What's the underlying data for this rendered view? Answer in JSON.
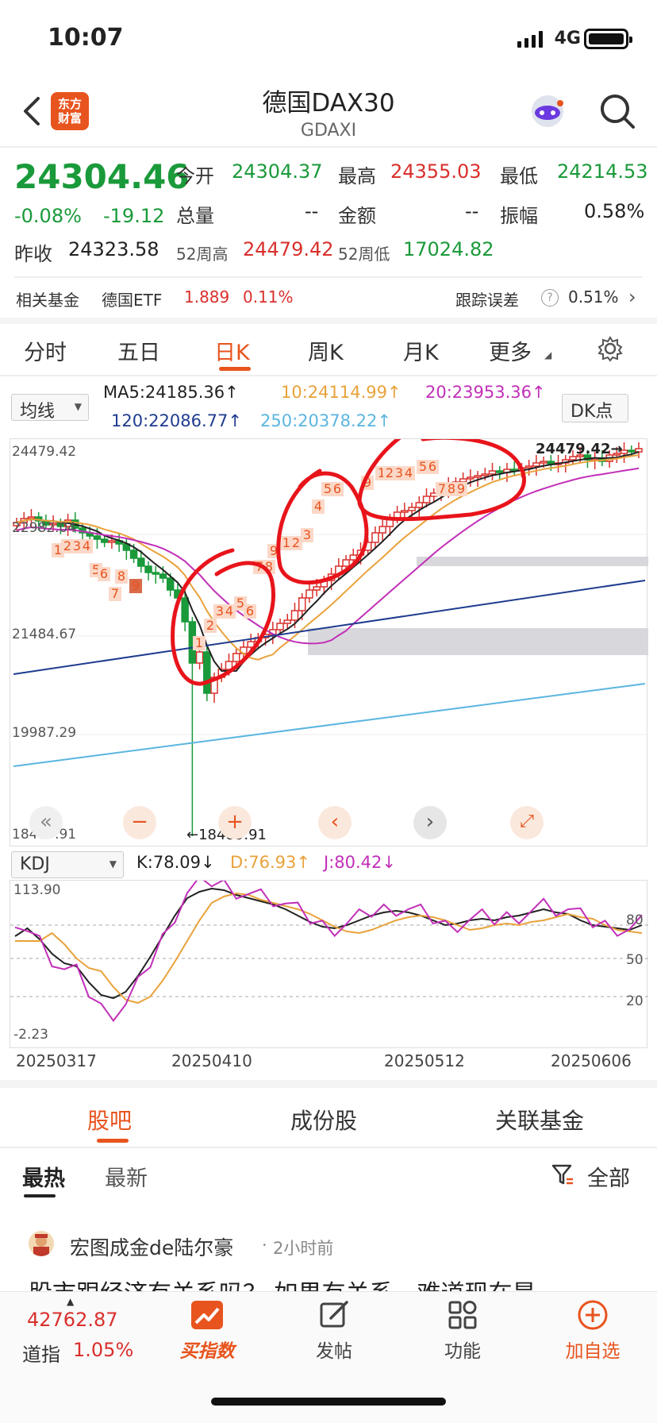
{
  "status": {
    "time": "10:07",
    "network": "4G"
  },
  "header": {
    "logo_text_1": "东方",
    "logo_text_2": "财富",
    "title": "德国DAX30",
    "subtitle": "GDAXI"
  },
  "quote": {
    "price": "24304.46",
    "change_pct": "-0.08%",
    "change_abs": "-19.12",
    "open_label": "今开",
    "open": "24304.37",
    "high_label": "最高",
    "high": "24355.03",
    "low_label": "最低",
    "low": "24214.53",
    "volume_label": "总量",
    "volume": "--",
    "amount_label": "金额",
    "amount": "--",
    "amplitude_label": "振幅",
    "amplitude": "0.58%",
    "prev_close_label": "昨收",
    "prev_close": "24323.58",
    "week52_high_label": "52周高",
    "week52_high": "24479.42",
    "week52_low_label": "52周低",
    "week52_low": "17024.82"
  },
  "fund": {
    "label": "相关基金",
    "name": "德国ETF",
    "price": "1.889",
    "change": "0.11%",
    "tracking_label": "跟踪误差",
    "tracking": "0.51%"
  },
  "tabs": [
    "分时",
    "五日",
    "日K",
    "周K",
    "月K",
    "更多"
  ],
  "active_tab": "日K",
  "indicator": {
    "ma_select": "均线",
    "ma5": "MA5:24185.36↑",
    "ma10": "10:24114.99↑",
    "ma20": "20:23953.36↑",
    "ma120": "120:22086.77↑",
    "ma250": "250:20378.22↑",
    "dk_button": "DK点"
  },
  "kline": {
    "y_labels": [
      "24479.42",
      "22982.04",
      "21484.67",
      "19987.29",
      "18489.91"
    ],
    "high_mark": "24479.42→",
    "low_mark": "←18489.91",
    "colors": {
      "up": "#d9302c",
      "down": "#1a9a3a",
      "ma5": "#222222",
      "ma10": "#e9a23b",
      "ma20": "#c22fb8",
      "ma120": "#1f3c8f",
      "ma250": "#5bb5e0",
      "annotation": "#e8141b"
    }
  },
  "kdj": {
    "select": "KDJ",
    "k": "K:78.09↓",
    "d": "D:76.93↑",
    "j": "J:80.42↓",
    "y_top": "113.90",
    "y_bottom": "-2.23",
    "levels": [
      "80",
      "50",
      "20"
    ],
    "dates": [
      "20250317",
      "20250410",
      "20250512",
      "20250606"
    ]
  },
  "chart_data": {
    "type": "candlestick",
    "x": [
      "20250317",
      "20250410",
      "20250512",
      "20250606"
    ],
    "ylim": [
      18489.91,
      24479.42
    ],
    "marked_high": 24479.42,
    "marked_low": 18489.91
  },
  "section_tabs": [
    "股吧",
    "成份股",
    "关联基金"
  ],
  "sub_tabs": [
    "最热",
    "最新"
  ],
  "filter_label": "全部",
  "post": {
    "author": "宏图成金de陆尔豪",
    "time": "2小时前",
    "text": "股市跟经济有关系吗？ 如果有关系，难道现在是"
  },
  "navbar": {
    "index_value": "42762.87",
    "index_name": "道指",
    "index_change": "1.05%",
    "items": [
      "买指数",
      "发帖",
      "功能",
      "加自选"
    ]
  }
}
